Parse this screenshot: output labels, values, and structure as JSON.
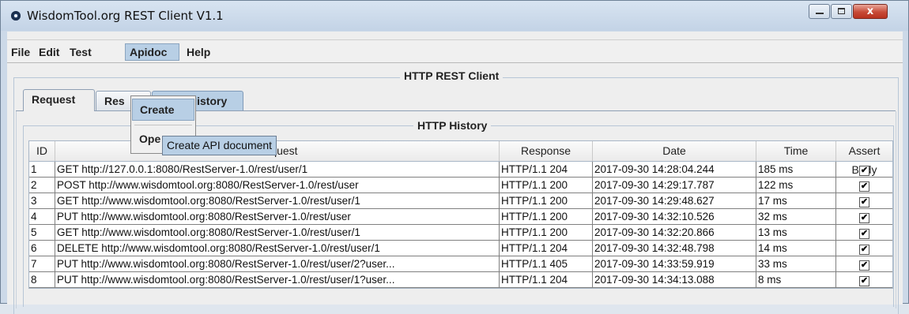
{
  "window": {
    "title": "WisdomTool.org REST Client V1.1",
    "close_glyph": "x"
  },
  "menubar": {
    "items": [
      "File",
      "Edit",
      "Test",
      "Apidoc",
      "Help"
    ]
  },
  "panel": {
    "title": "HTTP REST Client"
  },
  "tabs": {
    "request": "Request",
    "response": "Res",
    "history": "History"
  },
  "history": {
    "title": "HTTP History"
  },
  "table": {
    "columns": [
      "ID",
      "Request",
      "Response",
      "Date",
      "Time",
      "Assert Body"
    ],
    "rows": [
      {
        "id": "1",
        "request": "GET http://127.0.0.1:8080/RestServer-1.0/rest/user/1",
        "response": "HTTP/1.1 204",
        "date": "2017-09-30 14:28:04.244",
        "time": "185 ms",
        "assert": "✔"
      },
      {
        "id": "2",
        "request": "POST http://www.wisdomtool.org:8080/RestServer-1.0/rest/user",
        "response": "HTTP/1.1 200",
        "date": "2017-09-30 14:29:17.787",
        "time": "122 ms",
        "assert": "✔"
      },
      {
        "id": "3",
        "request": "GET http://www.wisdomtool.org:8080/RestServer-1.0/rest/user/1",
        "response": "HTTP/1.1 200",
        "date": "2017-09-30 14:29:48.627",
        "time": "17 ms",
        "assert": "✔"
      },
      {
        "id": "4",
        "request": "PUT http://www.wisdomtool.org:8080/RestServer-1.0/rest/user",
        "response": "HTTP/1.1 200",
        "date": "2017-09-30 14:32:10.526",
        "time": "32 ms",
        "assert": "✔"
      },
      {
        "id": "5",
        "request": "GET http://www.wisdomtool.org:8080/RestServer-1.0/rest/user/1",
        "response": "HTTP/1.1 200",
        "date": "2017-09-30 14:32:20.866",
        "time": "13 ms",
        "assert": "✔"
      },
      {
        "id": "6",
        "request": "DELETE http://www.wisdomtool.org:8080/RestServer-1.0/rest/user/1",
        "response": "HTTP/1.1 204",
        "date": "2017-09-30 14:32:48.798",
        "time": "14 ms",
        "assert": "✔"
      },
      {
        "id": "7",
        "request": "PUT http://www.wisdomtool.org:8080/RestServer-1.0/rest/user/2?user...",
        "response": "HTTP/1.1 405",
        "date": "2017-09-30 14:33:59.919",
        "time": "33 ms",
        "assert": "✔"
      },
      {
        "id": "8",
        "request": "PUT http://www.wisdomtool.org:8080/RestServer-1.0/rest/user/1?user...",
        "response": "HTTP/1.1 204",
        "date": "2017-09-30 14:34:13.088",
        "time": "8 ms",
        "assert": "✔"
      }
    ]
  },
  "apidoc_menu": {
    "items": [
      "Create",
      "Ope"
    ],
    "tooltip": "Create API document"
  }
}
